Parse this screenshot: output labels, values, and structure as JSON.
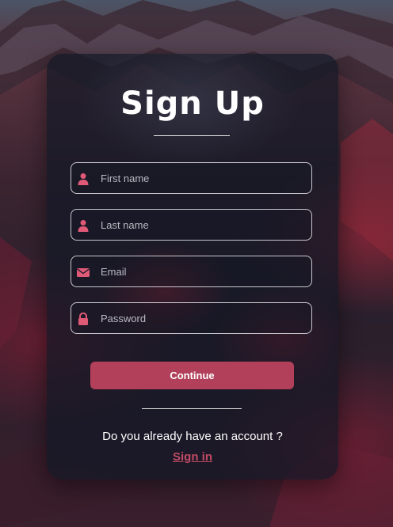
{
  "page": {
    "title": "Sign Up"
  },
  "form": {
    "first_name": {
      "placeholder": "First name",
      "value": "",
      "icon": "user-icon"
    },
    "last_name": {
      "placeholder": "Last name",
      "value": "",
      "icon": "user-icon"
    },
    "email": {
      "placeholder": "Email",
      "value": "",
      "icon": "envelope-icon"
    },
    "password": {
      "placeholder": "Password",
      "value": "",
      "icon": "lock-icon"
    },
    "submit_label": "Continue"
  },
  "footer": {
    "question": "Do you already have an account ?",
    "signin_label": "Sign in"
  },
  "colors": {
    "accent": "#b2405a",
    "link": "#c04a63",
    "icon": "#e05a78",
    "card": "#121826"
  }
}
